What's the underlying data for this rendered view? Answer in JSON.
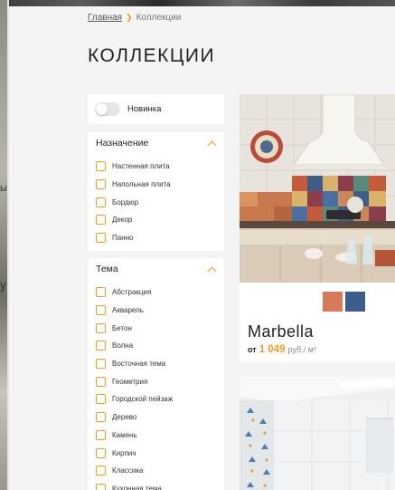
{
  "breadcrumb": {
    "home": "Главная",
    "current": "Коллекции"
  },
  "page_title": "КОЛЛЕКЦИИ",
  "side_fragments": {
    "a": "ы",
    "b": "у"
  },
  "filters": {
    "new_label": "Новинка",
    "purpose": {
      "title": "Назначение",
      "items": [
        "Настенная плита",
        "Напольная плита",
        "Бордюр",
        "Декор",
        "Панно"
      ]
    },
    "theme": {
      "title": "Тема",
      "items": [
        "Абстракция",
        "Акварель",
        "Бетон",
        "Волна",
        "Восточная тема",
        "Геометрия",
        "Городской пейзаж",
        "Дерево",
        "Камень",
        "Кирпич",
        "Классика",
        "Кухонная тема"
      ]
    }
  },
  "products": [
    {
      "name": "Marbella",
      "price_from": "от",
      "price": "1 049",
      "price_unit": "руб./ м²",
      "swatch_colors": [
        "#d77a5c",
        "#3d5d8c"
      ]
    }
  ],
  "colors": {
    "accent": "#f39a1c",
    "page_bg": "#f4f4f4",
    "panel_bg": "#ffffff"
  }
}
